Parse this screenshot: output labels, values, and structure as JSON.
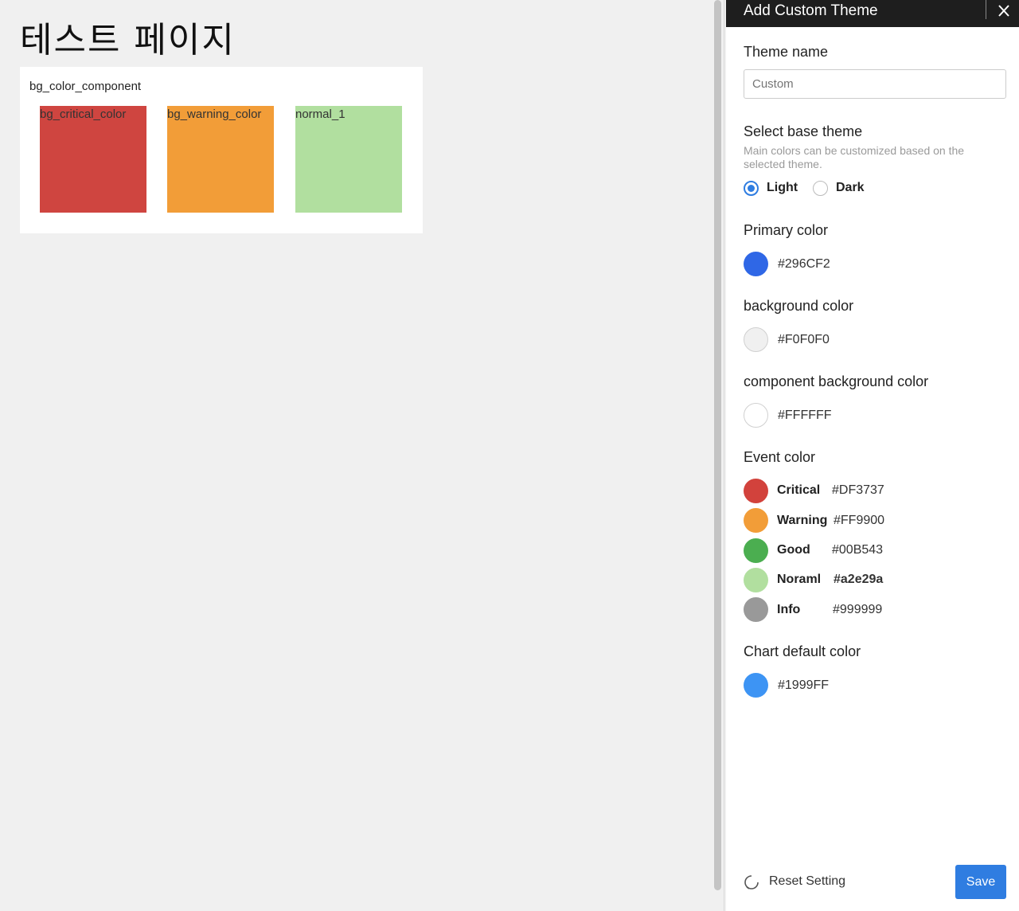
{
  "page": {
    "title": "테스트 페이지",
    "card": {
      "title": "bg_color_component",
      "swatches": [
        {
          "label": "bg_critical_color",
          "color": "#CF4540"
        },
        {
          "label": "bg_warning_color",
          "color": "#F29D38"
        },
        {
          "label": "normal_1",
          "color": "#B1DF9F"
        }
      ]
    }
  },
  "panel": {
    "title": "Add Custom Theme",
    "theme_name": {
      "label": "Theme name",
      "placeholder": "Custom"
    },
    "base_theme": {
      "label": "Select base theme",
      "help": "Main colors can be customized based on the selected theme.",
      "options": [
        {
          "label": "Light",
          "selected": true
        },
        {
          "label": "Dark",
          "selected": false
        }
      ]
    },
    "primary": {
      "label": "Primary color",
      "hex": "#296CF2",
      "color": "#2F67E6"
    },
    "background": {
      "label": "background color",
      "hex": "#F0F0F0",
      "color": "#F0F0F0"
    },
    "component_background": {
      "label": "component background color",
      "hex": "#FFFFFF",
      "color": "#FFFFFF"
    },
    "event": {
      "label": "Event color",
      "items": [
        {
          "name": "Critical",
          "hex": "#DF3737",
          "color": "#D2423C"
        },
        {
          "name": "Warning",
          "hex": "#FF9900",
          "color": "#F29D38"
        },
        {
          "name": "Good",
          "hex": "#00B543",
          "color": "#4BAE50"
        },
        {
          "name": "Noraml",
          "hex": "#a2e29a",
          "color": "#B1DF9F"
        },
        {
          "name": "Info",
          "hex": "#999999",
          "color": "#999999"
        }
      ]
    },
    "chart_default": {
      "label": "Chart default color",
      "hex": "#1999FF",
      "color": "#3D94F4"
    },
    "reset_label": "Reset Setting",
    "save_label": "Save"
  }
}
